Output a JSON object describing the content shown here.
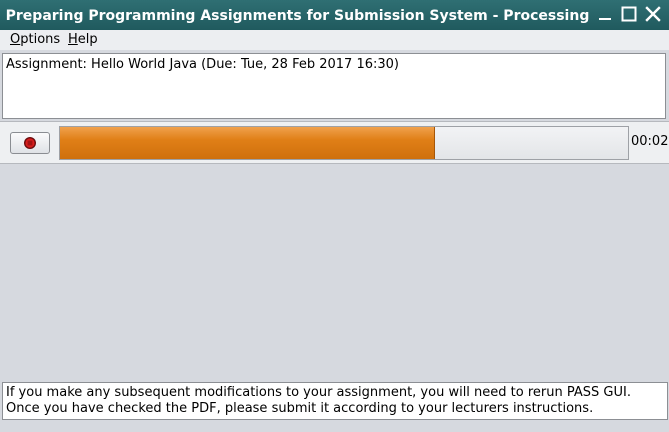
{
  "window": {
    "title": "Preparing Programming Assignments for Submission System - Processing",
    "controls": {
      "minimize_icon": "minimize-icon",
      "maximize_icon": "maximize-icon",
      "close_icon": "close-icon"
    }
  },
  "menubar": {
    "options": {
      "mnemonic": "O",
      "rest": "ptions"
    },
    "help": {
      "mnemonic": "H",
      "rest": "elp"
    }
  },
  "assignment": {
    "text": "Assignment: Hello World Java (Due: Tue, 28 Feb 2017 16:30)"
  },
  "progress": {
    "stop_icon": "stop-icon",
    "fraction": 0.66,
    "elapsed": "00:02",
    "fill_color": "#e07f17"
  },
  "info": {
    "message": "If you make any subsequent modifications to your assignment, you will need to rerun PASS GUI. Once you have checked the PDF, please submit it according to your lecturers instructions."
  },
  "colors": {
    "titlebar": "#2f6f73",
    "background": "#d6d9df"
  }
}
